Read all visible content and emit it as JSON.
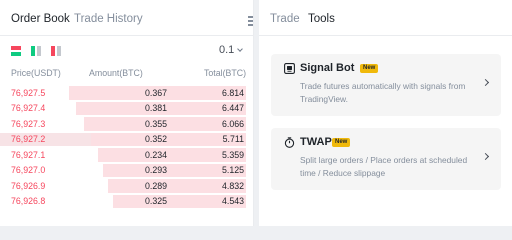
{
  "order_book": {
    "tabs": [
      {
        "label": "Order Book",
        "active": true
      },
      {
        "label": "Trade History",
        "active": false
      }
    ],
    "view_modes": [
      "both-icon",
      "bids-icon",
      "asks-icon"
    ],
    "tick_size": "0.1",
    "columns": {
      "price": "Price(USDT)",
      "amount": "Amount(BTC)",
      "total": "Total(BTC)"
    },
    "asks": [
      {
        "price": "76,927.5",
        "amount": "0.367",
        "total": "6.814",
        "depth": 0.72
      },
      {
        "price": "76,927.4",
        "amount": "0.381",
        "total": "6.447",
        "depth": 0.69
      },
      {
        "price": "76,927.3",
        "amount": "0.355",
        "total": "6.066",
        "depth": 0.66
      },
      {
        "price": "76,927.2",
        "amount": "0.352",
        "total": "5.711",
        "depth": 0.63
      },
      {
        "price": "76,927.1",
        "amount": "0.234",
        "total": "5.359",
        "depth": 0.6
      },
      {
        "price": "76,927.0",
        "amount": "0.293",
        "total": "5.125",
        "depth": 0.58
      },
      {
        "price": "76,926.9",
        "amount": "0.289",
        "total": "4.832",
        "depth": 0.56
      },
      {
        "price": "76,926.8",
        "amount": "0.325",
        "total": "4.543",
        "depth": 0.54
      }
    ],
    "highlighted_row": 3,
    "colors": {
      "ask": "#f6465d",
      "bid": "#0ecb81",
      "depth": "#fcdfe3"
    }
  },
  "tools_panel": {
    "tabs": [
      {
        "label": "Trade",
        "active": false
      },
      {
        "label": "Tools",
        "active": true
      }
    ],
    "cards": [
      {
        "icon": "signal-bot-icon",
        "title": "Signal Bot",
        "badge": "New",
        "description": "Trade futures automatically with signals from TradingView."
      },
      {
        "icon": "stopwatch-icon",
        "title": "TWAP",
        "badge": "New",
        "description": "Split large orders / Place orders at scheduled time / Reduce slippage"
      }
    ],
    "accent": "#f0b90b"
  }
}
